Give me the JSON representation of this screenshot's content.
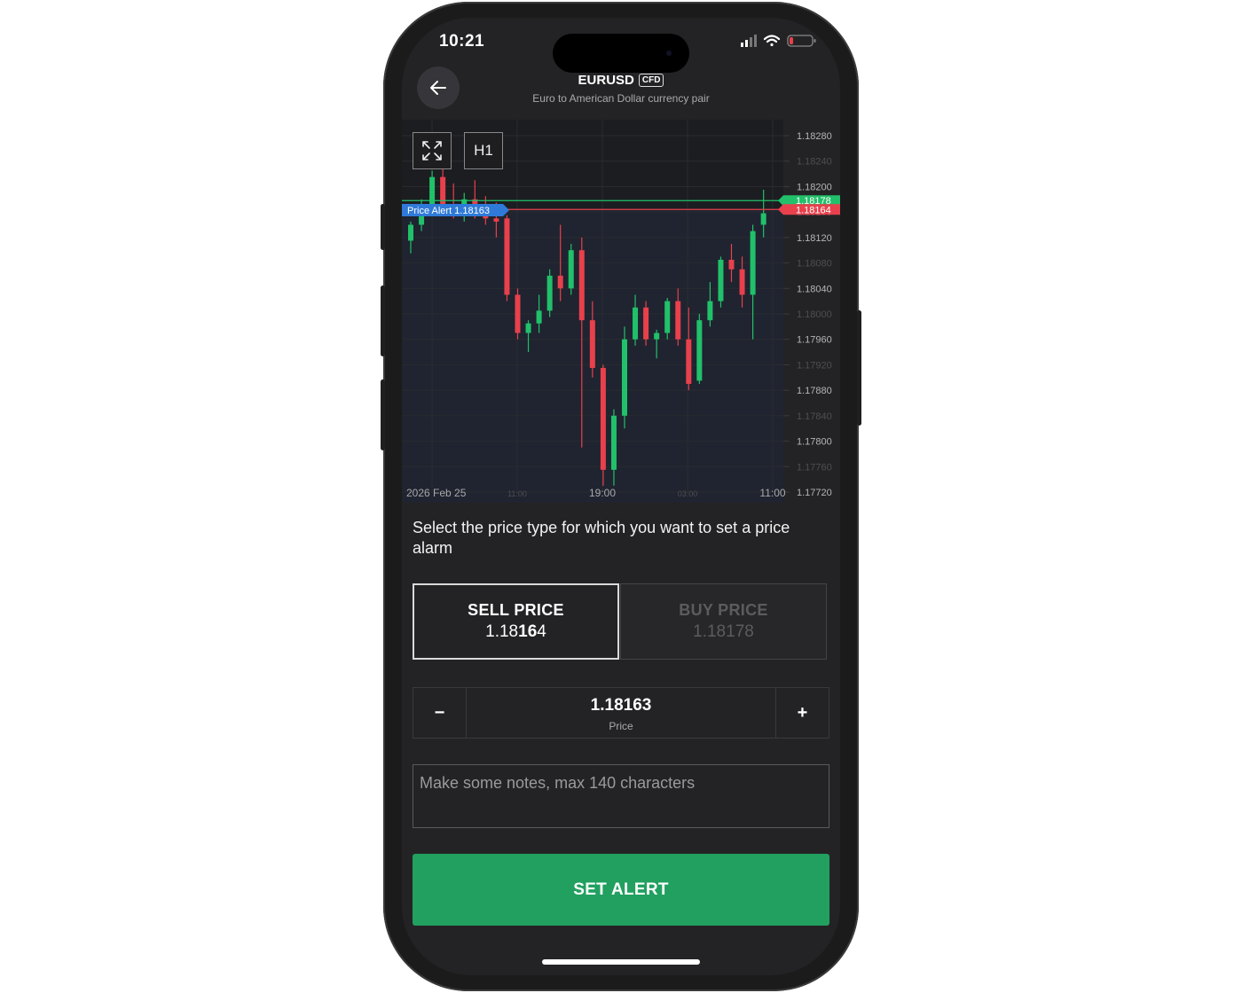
{
  "status_bar": {
    "time": "10:21"
  },
  "header": {
    "symbol": "EURUSD",
    "badge": "CFD",
    "subtitle": "Euro to American Dollar currency pair"
  },
  "chart_toolbar": {
    "timeframe": "H1"
  },
  "chart_data": {
    "type": "candlestick",
    "timeframe": "H1",
    "x_tick_labels": [
      "2026 Feb 25",
      "11:00",
      "19:00",
      "03:00",
      "11:00"
    ],
    "y_tick_labels": [
      "1.18280",
      "1.18240",
      "1.18200",
      "1.18160",
      "1.18120",
      "1.18080",
      "1.18040",
      "1.18000",
      "1.17960",
      "1.17920",
      "1.17880",
      "1.17840",
      "1.17800",
      "1.17760",
      "1.17720"
    ],
    "ylim": [
      1.1772,
      1.1828
    ],
    "price_lines": [
      {
        "label": "1.18178",
        "value": 1.18178,
        "color": "#21c06a"
      },
      {
        "label": "1.18164",
        "value": 1.18164,
        "color": "#e8404c"
      }
    ],
    "alert_label": "Price Alert 1.18163",
    "alert_value": 1.18163,
    "candles": [
      {
        "o": 1.18115,
        "h": 1.18145,
        "l": 1.18095,
        "c": 1.1814
      },
      {
        "o": 1.1814,
        "h": 1.1818,
        "l": 1.1813,
        "c": 1.1817
      },
      {
        "o": 1.1817,
        "h": 1.18225,
        "l": 1.1816,
        "c": 1.18215
      },
      {
        "o": 1.18215,
        "h": 1.1824,
        "l": 1.1816,
        "c": 1.1817
      },
      {
        "o": 1.1817,
        "h": 1.18205,
        "l": 1.1815,
        "c": 1.18165
      },
      {
        "o": 1.18165,
        "h": 1.1819,
        "l": 1.18145,
        "c": 1.1818
      },
      {
        "o": 1.1818,
        "h": 1.1821,
        "l": 1.1815,
        "c": 1.18165
      },
      {
        "o": 1.18165,
        "h": 1.18185,
        "l": 1.1814,
        "c": 1.1815
      },
      {
        "o": 1.1815,
        "h": 1.18175,
        "l": 1.1812,
        "c": 1.18145
      },
      {
        "o": 1.1815,
        "h": 1.18155,
        "l": 1.1802,
        "c": 1.1803
      },
      {
        "o": 1.1803,
        "h": 1.1804,
        "l": 1.1796,
        "c": 1.1797
      },
      {
        "o": 1.1797,
        "h": 1.1799,
        "l": 1.1794,
        "c": 1.17985
      },
      {
        "o": 1.17985,
        "h": 1.1803,
        "l": 1.1797,
        "c": 1.18005
      },
      {
        "o": 1.18005,
        "h": 1.1807,
        "l": 1.17995,
        "c": 1.1806
      },
      {
        "o": 1.1806,
        "h": 1.1814,
        "l": 1.1802,
        "c": 1.1804
      },
      {
        "o": 1.1804,
        "h": 1.1811,
        "l": 1.1803,
        "c": 1.181
      },
      {
        "o": 1.181,
        "h": 1.1812,
        "l": 1.1779,
        "c": 1.1799
      },
      {
        "o": 1.1799,
        "h": 1.1802,
        "l": 1.179,
        "c": 1.17915
      },
      {
        "o": 1.17915,
        "h": 1.1792,
        "l": 1.1773,
        "c": 1.17755
      },
      {
        "o": 1.17755,
        "h": 1.1785,
        "l": 1.1773,
        "c": 1.1784
      },
      {
        "o": 1.1784,
        "h": 1.1798,
        "l": 1.1782,
        "c": 1.1796
      },
      {
        "o": 1.1796,
        "h": 1.1803,
        "l": 1.1795,
        "c": 1.1801
      },
      {
        "o": 1.1801,
        "h": 1.1802,
        "l": 1.1795,
        "c": 1.1796
      },
      {
        "o": 1.1796,
        "h": 1.17975,
        "l": 1.1793,
        "c": 1.1797
      },
      {
        "o": 1.1797,
        "h": 1.18025,
        "l": 1.1796,
        "c": 1.1802
      },
      {
        "o": 1.1802,
        "h": 1.1804,
        "l": 1.1795,
        "c": 1.1796
      },
      {
        "o": 1.1796,
        "h": 1.1801,
        "l": 1.1788,
        "c": 1.1789
      },
      {
        "o": 1.17895,
        "h": 1.18,
        "l": 1.1789,
        "c": 1.1799
      },
      {
        "o": 1.1799,
        "h": 1.1805,
        "l": 1.1798,
        "c": 1.1802
      },
      {
        "o": 1.1802,
        "h": 1.1809,
        "l": 1.1801,
        "c": 1.18085
      },
      {
        "o": 1.18085,
        "h": 1.1811,
        "l": 1.1805,
        "c": 1.1807
      },
      {
        "o": 1.1807,
        "h": 1.1809,
        "l": 1.1801,
        "c": 1.1803
      },
      {
        "o": 1.1803,
        "h": 1.1814,
        "l": 1.1796,
        "c": 1.1813
      },
      {
        "o": 1.1814,
        "h": 1.18195,
        "l": 1.1812,
        "c": 1.18158
      }
    ]
  },
  "instruction": "Select the price type for which you want to set a price alarm",
  "price_type": {
    "sell": {
      "label": "SELL PRICE",
      "value_prefix": "1.18",
      "value_big": "16",
      "value_suffix": "4"
    },
    "buy": {
      "label": "BUY PRICE",
      "value_prefix": "1.18",
      "value_big": "17",
      "value_suffix": "8"
    },
    "selected": "sell"
  },
  "price_input": {
    "value": "1.18163",
    "label": "Price",
    "minus": "−",
    "plus": "+"
  },
  "notes": {
    "placeholder": "Make some notes, max 140 characters"
  },
  "cta": {
    "label": "SET ALERT"
  },
  "colors": {
    "up": "#21c06a",
    "down": "#e8404c",
    "alert": "#2f7ad8",
    "cta": "#21a05f",
    "background": "#232325"
  }
}
